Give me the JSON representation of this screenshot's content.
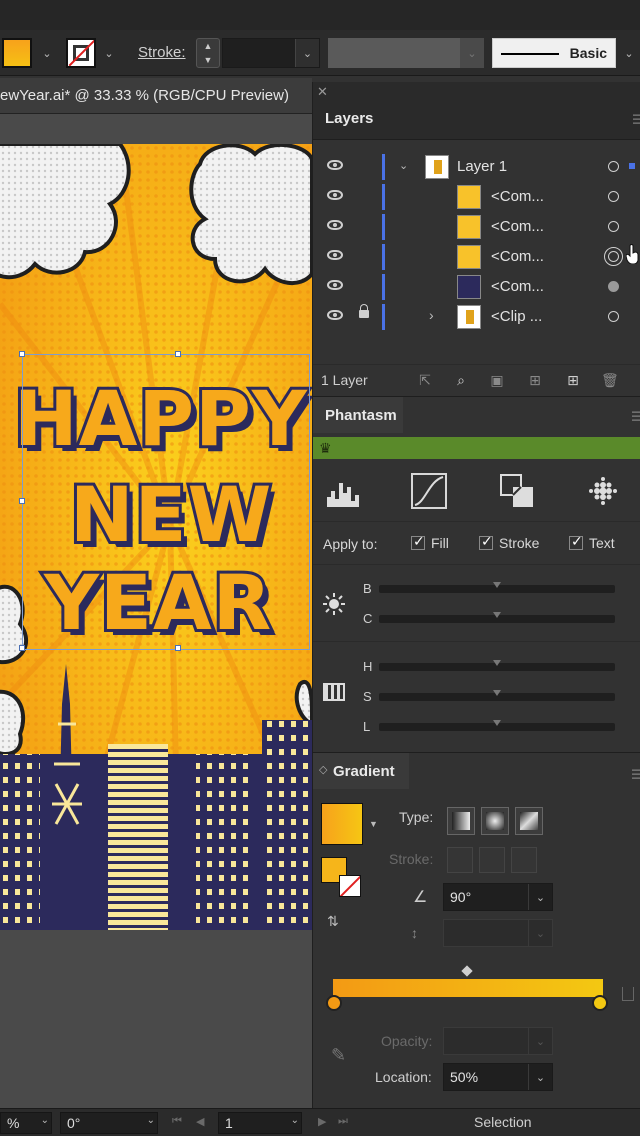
{
  "control_bar": {
    "stroke_label": "Stroke:",
    "brush_label": "Basic",
    "fill_color": "#F7A21B"
  },
  "document": {
    "tab_title": "ewYear.ai* @ 33.33 % (RGB/CPU Preview)"
  },
  "artwork": {
    "line1": "HAPPY",
    "line2": "NEW",
    "line3": "YEAR"
  },
  "layers_panel": {
    "title": "Layers",
    "rows": [
      {
        "label": "Layer 1",
        "thumb": "layer-thumb"
      },
      {
        "label": "<Com...",
        "thumb": "year-thumb"
      },
      {
        "label": "<Com...",
        "thumb": "happy-thumb"
      },
      {
        "label": "<Com...",
        "thumb": "new-thumb"
      },
      {
        "label": "<Com...",
        "thumb": "city-thumb"
      },
      {
        "label": "<Clip ...",
        "thumb": "clip-thumb"
      }
    ],
    "footer_count": "1 Layer"
  },
  "phantasm_panel": {
    "title": "Phantasm",
    "apply_to_label": "Apply to:",
    "checks": {
      "fill": "Fill",
      "stroke": "Stroke",
      "text": "Text"
    },
    "sliders": {
      "b": "B",
      "c": "C",
      "h": "H",
      "s": "S",
      "l": "L"
    },
    "slider_positions": {
      "b": 0.5,
      "c": 0.5,
      "h": 0.5,
      "s": 0.5,
      "l": 0.5
    }
  },
  "gradient_panel": {
    "title": "Gradient",
    "type_label": "Type:",
    "stroke_label": "Stroke:",
    "angle_value": "90°",
    "opacity_label": "Opacity:",
    "location_label": "Location:",
    "location_value": "50%",
    "start_color": "#F39A14",
    "end_color": "#F3C812"
  },
  "status_bar": {
    "zoom_value": "%",
    "rotate_value": "0°",
    "artboard_value": "1",
    "tool_mode": "Selection"
  }
}
